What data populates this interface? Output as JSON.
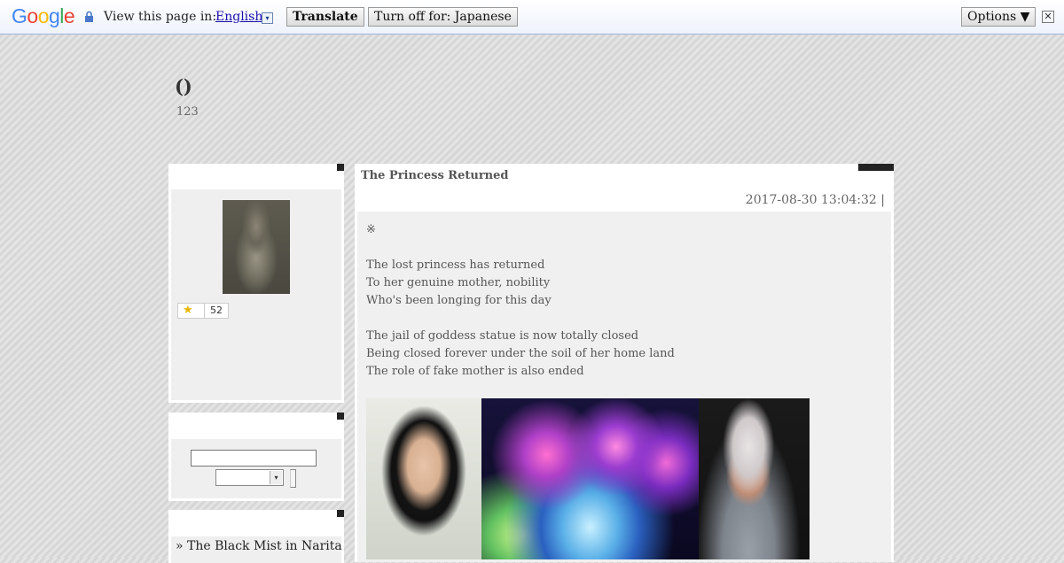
{
  "translate_bar": {
    "logo": "Google",
    "view_text": "View this page in:",
    "language": "English",
    "language_dropdown_glyph": "▾",
    "translate_label": "Translate",
    "turn_off_label": "Turn off for: Japanese",
    "options_label": "Options ▼",
    "close_glyph": "✕"
  },
  "site": {
    "title": "()",
    "subtitle": "123"
  },
  "sidebar": {
    "profile": {
      "star_glyph": "★",
      "star_count": "52"
    },
    "search": {
      "input_value": "",
      "select_value": "",
      "select_arrow": "▾"
    },
    "links": [
      {
        "label": "» The Black Mist in Narita"
      }
    ]
  },
  "post": {
    "title": "The Princess Returned",
    "date": "2017-08-30 13:04:32 |",
    "mark": "※",
    "stanza1": [
      "The lost princess has returned",
      "To her genuine mother, nobility",
      "Who's been longing for this day"
    ],
    "stanza2": [
      "The jail of goddess statue is now totally closed",
      "Being closed forever under the soil of her home land",
      "The role of fake mother is also ended"
    ]
  },
  "colors": {
    "link": "#1a0dab",
    "star": "#e8b600",
    "accent_dark": "#222222"
  }
}
